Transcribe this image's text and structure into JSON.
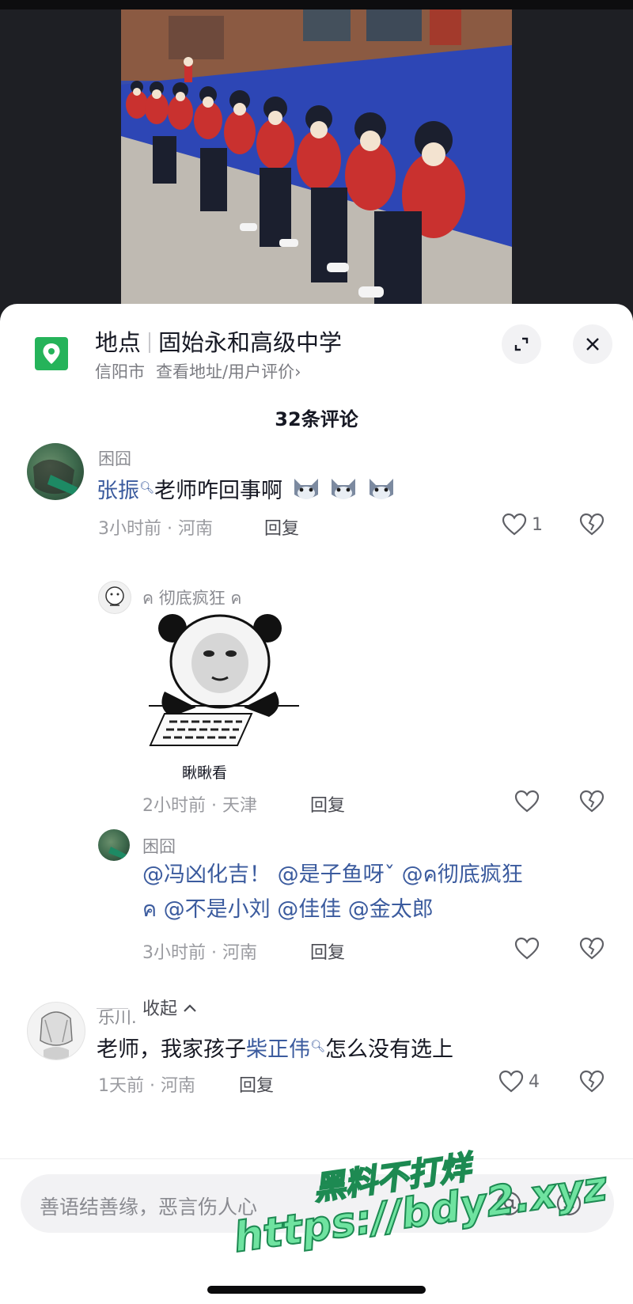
{
  "location": {
    "label": "地点",
    "name": "固始永和高级中学",
    "city": "信阳市",
    "link": "查看地址/用户评价",
    "link_arrow": "›"
  },
  "comment_count": "32条评论",
  "comments": [
    {
      "user": "困囧",
      "text_parts": {
        "mention": "张振",
        "rest": "老师咋回事啊"
      },
      "emoji_count": 3,
      "time": "3小时前 · 河南",
      "reply_label": "回复",
      "likes": "1",
      "replies": [
        {
          "user": "ค 彻底疯狂 ค",
          "sticker_caption": "瞅瞅看",
          "time": "2小时前 · 天津",
          "reply_label": "回复",
          "likes": ""
        },
        {
          "user": "困囧",
          "line1": "@冯凶化吉！ @是子鱼呀ˇ @ค彻底疯狂",
          "line2": "ค @不是小刘 @佳佳 @金太郎",
          "time": "3小时前 · 河南",
          "reply_label": "回复",
          "likes": ""
        }
      ],
      "collapse_label": "收起"
    },
    {
      "user": "乐川.",
      "text_parts": {
        "before": "老师，我家孩子",
        "mention": "柴正伟",
        "after": "怎么没有选上"
      },
      "time": "1天前 · 河南",
      "reply_label": "回复",
      "likes": "4"
    }
  ],
  "input": {
    "placeholder": "善语结善缘，恶言伤人心"
  },
  "watermark": {
    "line1": "黑料不打烊",
    "line2": "https://bdy2.xyz"
  },
  "icons": {
    "location": "map-pin-icon",
    "expand": "expand-icon",
    "close": "close-icon",
    "like": "heart-icon",
    "dislike": "broken-heart-icon",
    "search_mark": "search-mark-icon",
    "mention_input": "at-icon",
    "emoji_input": "emoji-icon"
  },
  "colors": {
    "accent_green": "#25b35a",
    "mention_blue": "#3b5b9e",
    "watermark": "#6fe3a0"
  }
}
